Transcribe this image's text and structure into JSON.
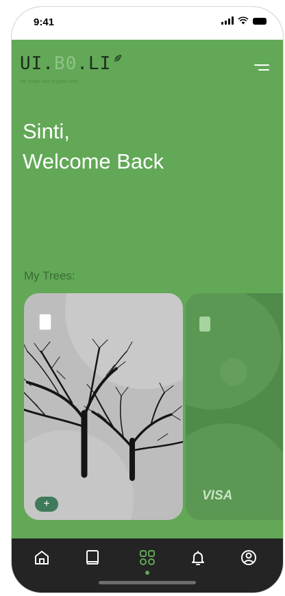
{
  "status": {
    "time": "9:41"
  },
  "header": {
    "logo_prefix": "UI.",
    "logo_mid": "B0",
    "logo_suffix": ".LI",
    "tagline": "the smart way to grow trees"
  },
  "greeting": {
    "line1": "Sinti,",
    "line2": "Welcome Back"
  },
  "trees_section": {
    "title": "My Trees:"
  },
  "cards": [
    {
      "add_label": "+"
    },
    {
      "brand": "VISA",
      "more": "··"
    }
  ],
  "tabs": [
    {
      "name": "home-icon",
      "active": false
    },
    {
      "name": "book-icon",
      "active": false
    },
    {
      "name": "grid-icon",
      "active": true
    },
    {
      "name": "bell-icon",
      "active": false
    },
    {
      "name": "user-icon",
      "active": false
    }
  ],
  "colors": {
    "accent": "#62a857",
    "tabbar": "#242424",
    "card_grey": "#bdbdbd",
    "card_green": "#4f8c4a"
  }
}
